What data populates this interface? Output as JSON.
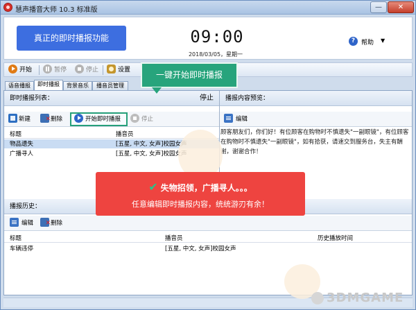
{
  "window": {
    "title": "慧声播音大师 10.3 标准版",
    "minimize_glyph": "—",
    "close_glyph": "✕"
  },
  "header": {
    "feature_banner": "真正的即时播报功能",
    "clock": "09:00",
    "date": "2018/03/05，星期一",
    "help_label": "帮助",
    "help_glyph": "?",
    "help_arrow": "▼"
  },
  "toolbar": {
    "start": "开始",
    "pause": "暂停",
    "stop": "停止",
    "settings": "设置"
  },
  "tabs": [
    "语音播报",
    "即时播报",
    "背景音乐",
    "播音员管理"
  ],
  "instant_list": {
    "section_title": "即时播报列表：",
    "status": "停止",
    "new": "新建",
    "delete": "删除",
    "start_instant": "开始即时播报",
    "stop": "停止",
    "columns": [
      "标题",
      "播音员"
    ],
    "rows": [
      {
        "title": "物品遗失",
        "announcer": "[五星, 中文, 女声]校园女声"
      },
      {
        "title": "广播寻人",
        "announcer": "[五星, 中文, 女声]校园女声"
      }
    ]
  },
  "preview": {
    "section_title": "播报内容预览：",
    "edit": "编辑",
    "text": "顾客朋友们，你们好！有位顾客在购物时不慎遗失\"一副眼镜\"，有位顾客在购物时不慎遗失\"一副眼镜\"，如有拾获，请速交到服务台，失主有酬谢，谢谢合作！"
  },
  "history": {
    "section_title": "播报历史：",
    "edit": "编辑",
    "delete": "删除",
    "columns": [
      "标题",
      "播音员",
      "历史播放时间"
    ],
    "rows": [
      {
        "title": "车辆违停",
        "announcer": "[五星, 中文, 女声]校园女声",
        "time": ""
      }
    ]
  },
  "callouts": {
    "green": "一键开始即时播报",
    "red_check": "✔",
    "red_title": "失物招领，广播寻人。。。",
    "red_sub": "任意编辑即时播报内容，统统游刃有余！"
  },
  "watermark": "3DMGAME",
  "colors": {
    "banner_blue": "#3d6ee0",
    "callout_green": "#27a47c",
    "callout_red": "#ee4440",
    "selected_row": "#c9dcf3"
  }
}
